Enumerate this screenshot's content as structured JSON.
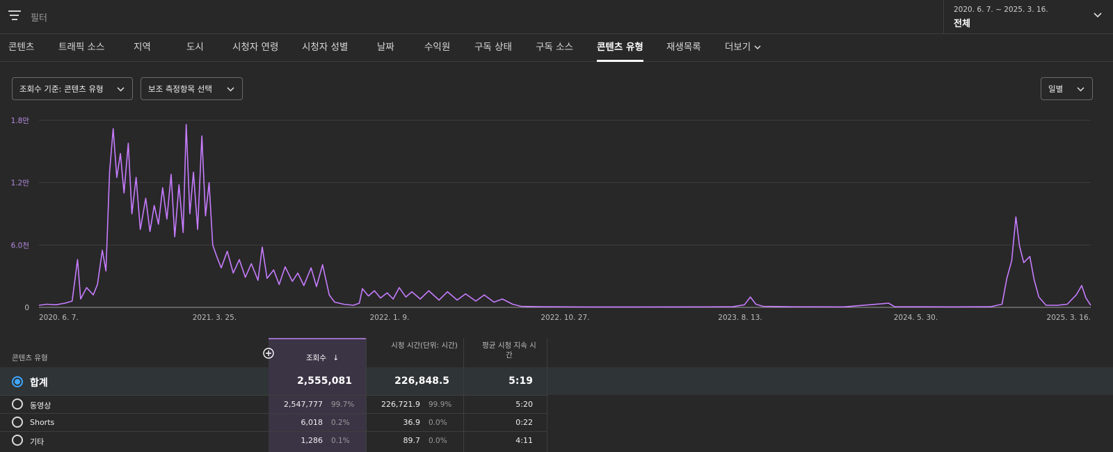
{
  "filter": {
    "label": "필터"
  },
  "date_range": {
    "range": "2020. 6. 7. ~ 2025. 3. 16.",
    "period": "전체"
  },
  "tabs": [
    {
      "label": "콘텐츠"
    },
    {
      "label": "트래픽 소스"
    },
    {
      "label": "지역"
    },
    {
      "label": "도시"
    },
    {
      "label": "시청자 연령"
    },
    {
      "label": "시청자 성별"
    },
    {
      "label": "날짜"
    },
    {
      "label": "수익원"
    },
    {
      "label": "구독 상태"
    },
    {
      "label": "구독 소스"
    },
    {
      "label": "콘텐츠 유형",
      "active": true
    },
    {
      "label": "재생목록"
    },
    {
      "label": "더보기"
    }
  ],
  "selectors": {
    "metric": "조회수 기준: 콘텐츠 유형",
    "secondary": "보조 측정항목 선택",
    "granularity": "일별"
  },
  "chart_data": {
    "type": "line",
    "y_tick_labels": [
      "0",
      "6.0천",
      "1.2만",
      "1.8만"
    ],
    "y_ticks": [
      0,
      6000,
      12000,
      18000
    ],
    "ylim": [
      0,
      18000
    ],
    "x_tick_labels": [
      "2020. 6. 7.",
      "2021. 3. 25.",
      "2022. 1. 9.",
      "2022. 10. 27.",
      "2023. 8. 13.",
      "2024. 5. 30.",
      "2025. 3. 16."
    ],
    "x_ticks": [
      "2020-06-07",
      "2021-03-25",
      "2022-01-09",
      "2022-10-27",
      "2023-08-13",
      "2024-05-30",
      "2025-03-16"
    ],
    "series": [
      {
        "color": "#c77dff",
        "points": [
          [
            "2020-06-07",
            200
          ],
          [
            "2020-06-20",
            300
          ],
          [
            "2020-07-05",
            250
          ],
          [
            "2020-07-20",
            400
          ],
          [
            "2020-08-01",
            600
          ],
          [
            "2020-08-10",
            4600
          ],
          [
            "2020-08-15",
            800
          ],
          [
            "2020-08-25",
            1900
          ],
          [
            "2020-09-05",
            1200
          ],
          [
            "2020-09-12",
            2200
          ],
          [
            "2020-09-20",
            5500
          ],
          [
            "2020-09-26",
            3500
          ],
          [
            "2020-10-02",
            13000
          ],
          [
            "2020-10-08",
            17200
          ],
          [
            "2020-10-14",
            12500
          ],
          [
            "2020-10-20",
            14800
          ],
          [
            "2020-10-26",
            11000
          ],
          [
            "2020-11-02",
            15800
          ],
          [
            "2020-11-08",
            9000
          ],
          [
            "2020-11-15",
            12500
          ],
          [
            "2020-11-22",
            7500
          ],
          [
            "2020-12-01",
            10500
          ],
          [
            "2020-12-08",
            7300
          ],
          [
            "2020-12-15",
            9800
          ],
          [
            "2020-12-22",
            8000
          ],
          [
            "2020-12-29",
            11500
          ],
          [
            "2021-01-05",
            8500
          ],
          [
            "2021-01-12",
            12800
          ],
          [
            "2021-01-18",
            6800
          ],
          [
            "2021-01-25",
            11800
          ],
          [
            "2021-02-01",
            7200
          ],
          [
            "2021-02-06",
            17600
          ],
          [
            "2021-02-12",
            9000
          ],
          [
            "2021-02-18",
            13000
          ],
          [
            "2021-02-25",
            7500
          ],
          [
            "2021-03-04",
            16500
          ],
          [
            "2021-03-10",
            8800
          ],
          [
            "2021-03-16",
            12000
          ],
          [
            "2021-03-22",
            6000
          ],
          [
            "2021-03-28",
            5000
          ],
          [
            "2021-04-05",
            3800
          ],
          [
            "2021-04-15",
            5400
          ],
          [
            "2021-04-25",
            3300
          ],
          [
            "2021-05-05",
            4600
          ],
          [
            "2021-05-15",
            2900
          ],
          [
            "2021-05-25",
            4200
          ],
          [
            "2021-06-05",
            2600
          ],
          [
            "2021-06-12",
            5800
          ],
          [
            "2021-06-20",
            2800
          ],
          [
            "2021-07-01",
            3600
          ],
          [
            "2021-07-10",
            2200
          ],
          [
            "2021-07-20",
            3900
          ],
          [
            "2021-08-01",
            2500
          ],
          [
            "2021-08-10",
            3300
          ],
          [
            "2021-08-20",
            2100
          ],
          [
            "2021-09-01",
            3800
          ],
          [
            "2021-09-10",
            2000
          ],
          [
            "2021-09-20",
            4100
          ],
          [
            "2021-10-01",
            1200
          ],
          [
            "2021-10-10",
            500
          ],
          [
            "2021-10-25",
            300
          ],
          [
            "2021-11-10",
            200
          ],
          [
            "2021-11-20",
            400
          ],
          [
            "2021-11-25",
            1800
          ],
          [
            "2021-12-05",
            1100
          ],
          [
            "2021-12-15",
            1600
          ],
          [
            "2021-12-25",
            900
          ],
          [
            "2022-01-05",
            1400
          ],
          [
            "2022-01-15",
            800
          ],
          [
            "2022-01-25",
            1900
          ],
          [
            "2022-02-05",
            1000
          ],
          [
            "2022-02-15",
            1500
          ],
          [
            "2022-03-01",
            800
          ],
          [
            "2022-03-15",
            1600
          ],
          [
            "2022-04-01",
            700
          ],
          [
            "2022-04-15",
            1500
          ],
          [
            "2022-05-01",
            700
          ],
          [
            "2022-05-15",
            1300
          ],
          [
            "2022-06-01",
            600
          ],
          [
            "2022-06-15",
            1200
          ],
          [
            "2022-07-01",
            500
          ],
          [
            "2022-07-15",
            800
          ],
          [
            "2022-08-01",
            300
          ],
          [
            "2022-08-15",
            100
          ],
          [
            "2022-09-15",
            60
          ],
          [
            "2022-12-01",
            40
          ],
          [
            "2023-03-01",
            40
          ],
          [
            "2023-06-01",
            50
          ],
          [
            "2023-08-01",
            60
          ],
          [
            "2023-08-20",
            250
          ],
          [
            "2023-08-30",
            1000
          ],
          [
            "2023-09-08",
            300
          ],
          [
            "2023-09-20",
            100
          ],
          [
            "2023-11-01",
            60
          ],
          [
            "2024-02-01",
            50
          ],
          [
            "2024-04-15",
            400
          ],
          [
            "2024-04-25",
            60
          ],
          [
            "2024-08-01",
            50
          ],
          [
            "2024-10-01",
            60
          ],
          [
            "2024-10-20",
            300
          ],
          [
            "2024-10-28",
            2800
          ],
          [
            "2024-11-05",
            4500
          ],
          [
            "2024-11-12",
            8700
          ],
          [
            "2024-11-18",
            5900
          ],
          [
            "2024-11-25",
            4300
          ],
          [
            "2024-12-05",
            4900
          ],
          [
            "2024-12-12",
            2700
          ],
          [
            "2024-12-20",
            1000
          ],
          [
            "2025-01-01",
            200
          ],
          [
            "2025-01-20",
            200
          ],
          [
            "2025-02-05",
            300
          ],
          [
            "2025-02-20",
            1200
          ],
          [
            "2025-03-01",
            2100
          ],
          [
            "2025-03-08",
            900
          ],
          [
            "2025-03-16",
            200
          ]
        ]
      }
    ],
    "legend": "none",
    "grid": true
  },
  "table": {
    "headers": {
      "dimension": "콘텐츠 유형",
      "views": "조회수",
      "watch_time": "시청 시간(단위: 시간)",
      "avg_duration": "평균 시청 지속 시간"
    },
    "sort_indicator": "↓",
    "total": {
      "label": "합계",
      "views": "2,555,081",
      "watch_time": "226,848.5",
      "avg_duration": "5:19"
    },
    "rows": [
      {
        "label": "동영상",
        "views": "2,547,777",
        "views_pct": "99.7%",
        "watch_time": "226,721.9",
        "watch_pct": "99.9%",
        "avg_duration": "5:20"
      },
      {
        "label": "Shorts",
        "views": "6,018",
        "views_pct": "0.2%",
        "watch_time": "36.9",
        "watch_pct": "0.0%",
        "avg_duration": "0:22"
      },
      {
        "label": "기타",
        "views": "1,286",
        "views_pct": "0.1%",
        "watch_time": "89.7",
        "watch_pct": "0.0%",
        "avg_duration": "4:11"
      }
    ]
  }
}
